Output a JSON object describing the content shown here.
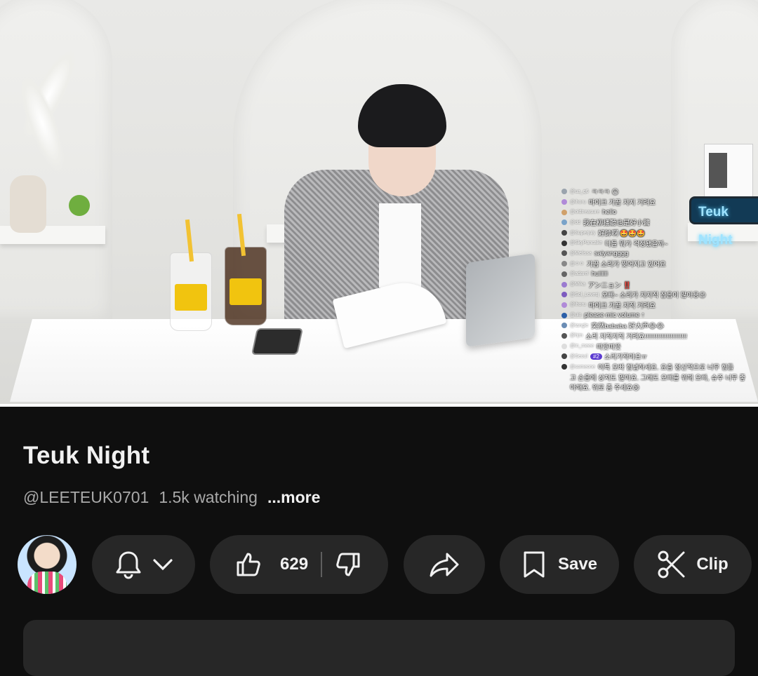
{
  "video": {
    "sign_text": "Teuk Night",
    "chat": [
      {
        "user": "@ua_q6",
        "text": "ㅋㅋㅋ 😀",
        "color": "#9aa3ad"
      },
      {
        "user": "@ihoru",
        "text": "마이크 가끔 지지 거려요",
        "color": "#b08ad8"
      },
      {
        "user": "@oldtreasure",
        "text": "hello",
        "color": "#d0a06a"
      },
      {
        "user": "@dd",
        "text": "我在柳播聽也是好小聲",
        "color": "#7aa3c9"
      },
      {
        "user": "@Superjuly",
        "text": "好帥啊 🤩🤩🤩",
        "color": "#444"
      },
      {
        "user": "@SkyPancake",
        "text": "다들 뭐가 걱정됐을까~",
        "color": "#333"
      },
      {
        "user": "@Melissa",
        "text": "saiyangggg",
        "color": "#555"
      },
      {
        "user": "@ㅇㅇ",
        "text": "가끔 소리가 찢어지고 있어요",
        "color": "#888"
      },
      {
        "user": "@adarel",
        "text": "huiiiiii",
        "color": "#666"
      },
      {
        "user": "@Mika",
        "text": "アンニョン ‼️",
        "color": "#9b7bd0"
      },
      {
        "user": "@Sol_Lovesj",
        "text": "오빠~ 소리가 지지직 잡음이 많아용😉",
        "color": "#7d5bbf"
      },
      {
        "user": "@ihoru",
        "text": "마이크 가끔 지직 거려요",
        "color": "#b08ad8"
      },
      {
        "user": "@ulo",
        "text": "please mic volume ↑",
        "color": "#2b5fa8"
      },
      {
        "user": "@tangle",
        "text": "突然bababa 好大声😂😂",
        "color": "#6b8db5"
      },
      {
        "user": "@hjm",
        "text": "소리 지직지직 거려요!!!!!!!!!!!!!!!!!!!!!!!",
        "color": "#555"
      },
      {
        "user": "@in_meee",
        "text": "따뜻따뜻",
        "color": "#ddd"
      },
      {
        "user": "@Seoul",
        "badge": "#2",
        "text": "소리가작아요ㅠ",
        "color": "#444"
      },
      {
        "user": "@someone",
        "text": "이특 오빠 힘냅하세요. 요즘 정신적으로 너무 힘들",
        "color": "#333"
      },
      {
        "user": "",
        "text": "고 손음에 상처도 많아요. 그래도 오빠를 위해 오빠, 슈주 너무 좋",
        "color": "#333"
      },
      {
        "user": "",
        "text": "아해요. 위로 좀 주세요😢",
        "color": "#333"
      }
    ],
    "progress_fraction": 1.0
  },
  "info": {
    "title": "Teuk Night",
    "channel_handle": "@LEETEUK0701",
    "watching": "1.5k watching",
    "more_label": "...more"
  },
  "actions": {
    "like_count": "629",
    "save_label": "Save",
    "clip_label": "Clip"
  },
  "colors": {
    "background": "#0f0f0f",
    "pill": "#272727",
    "text_primary": "#f1f1f1",
    "text_secondary": "#aaaaaa"
  },
  "icons": [
    "bell-icon",
    "chevron-down-icon",
    "thumbs-up-icon",
    "thumbs-down-icon",
    "share-icon",
    "bookmark-icon",
    "scissors-icon"
  ]
}
